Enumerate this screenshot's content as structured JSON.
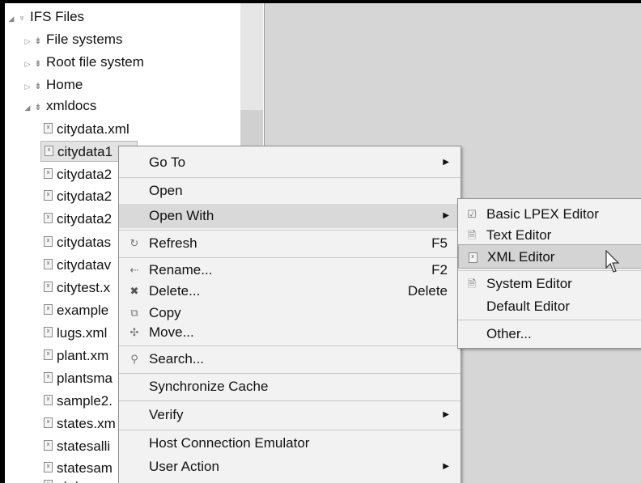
{
  "tree": {
    "root": "IFS Files",
    "items": [
      {
        "label": "File systems",
        "type": "folder"
      },
      {
        "label": "Root file system",
        "type": "folder"
      },
      {
        "label": "Home",
        "type": "folder"
      },
      {
        "label": "xmldocs",
        "type": "folder",
        "expanded": true
      }
    ],
    "files": [
      "citydata.xml",
      "citydata1",
      "citydata2",
      "citydata2",
      "citydata2",
      "citydatas",
      "citydatav",
      "citytest.x",
      "example",
      "lugs.xml",
      "plant.xm",
      "plantsma",
      "sample2.",
      "states.xm",
      "statesalli",
      "statesam",
      "statesam"
    ],
    "selected_index": 1
  },
  "context_menu": {
    "items": [
      {
        "label": "Go To",
        "submenu": true
      },
      {
        "label": "Open"
      },
      {
        "label": "Open With",
        "submenu": true,
        "highlighted": true
      },
      {
        "label": "Refresh",
        "shortcut": "F5",
        "icon": "refresh-icon"
      },
      {
        "label": "Rename...",
        "shortcut": "F2",
        "icon": "rename-icon"
      },
      {
        "label": "Delete...",
        "shortcut": "Delete",
        "icon": "delete-icon"
      },
      {
        "label": "Copy",
        "icon": "copy-icon"
      },
      {
        "label": "Move...",
        "icon": "move-icon"
      },
      {
        "label": "Search...",
        "icon": "search-icon"
      },
      {
        "label": "Synchronize Cache"
      },
      {
        "label": "Verify",
        "submenu": true
      },
      {
        "label": "Host Connection Emulator"
      },
      {
        "label": "User Action",
        "submenu": true
      }
    ]
  },
  "open_with_menu": {
    "items": [
      {
        "label": "Basic LPEX Editor",
        "icon": "lpex-editor-icon"
      },
      {
        "label": "Text Editor",
        "icon": "text-file-icon"
      },
      {
        "label": "XML Editor",
        "icon": "xml-file-icon",
        "highlighted": true
      },
      {
        "label": "System Editor",
        "icon": "system-editor-icon"
      },
      {
        "label": "Default Editor"
      },
      {
        "label": "Other..."
      }
    ]
  }
}
